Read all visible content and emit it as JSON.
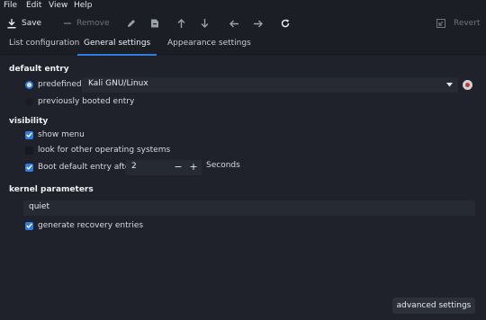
{
  "menubar": {
    "file": "File",
    "edit": "Edit",
    "view": "View",
    "help": "Help"
  },
  "toolbar": {
    "save_label": "Save",
    "remove_label": "Remove",
    "revert_label": "Revert"
  },
  "tabs": [
    {
      "label": "List configuration"
    },
    {
      "label": "General settings"
    },
    {
      "label": "Appearance settings"
    }
  ],
  "default_entry": {
    "heading": "default entry",
    "predefined_label": "predefined:",
    "predefined_value": "Kali GNU/Linux",
    "previous_label": "previously booted entry"
  },
  "visibility": {
    "heading": "visibility",
    "show_menu_label": "show menu",
    "other_os_label": "look for other operating systems",
    "boot_after_label": "Boot default entry after",
    "timeout_value": "2",
    "timeout_unit": "Seconds"
  },
  "kernel": {
    "heading": "kernel parameters",
    "params_value": "quiet",
    "recovery_label": "generate recovery entries"
  },
  "footer": {
    "advanced_label": "advanced settings"
  },
  "colors": {
    "accent": "#2f7de1",
    "background": "#1f222a",
    "bar": "#1b1e24"
  }
}
